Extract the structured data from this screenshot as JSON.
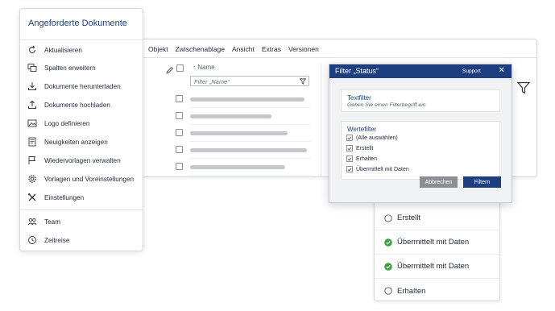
{
  "menubar": [
    "Objekt",
    "Zwischenablage",
    "Ansicht",
    "Extras",
    "Versionen"
  ],
  "grid": {
    "name_header": "↑ Name",
    "filter_placeholder": "Filter „Name“",
    "row_bar_fractions": [
      0.96,
      0.68,
      0.82,
      0.98,
      0.8
    ]
  },
  "sidebar": {
    "title": "Angeforderte Dokumente",
    "items": [
      {
        "label": "Aktualisieren",
        "icon": "refresh-icon"
      },
      {
        "label": "Spalten erweitern",
        "icon": "columns-icon"
      },
      {
        "label": "Dokumente herunterladen",
        "icon": "download-icon"
      },
      {
        "label": "Dokumente hochladen",
        "icon": "upload-icon"
      },
      {
        "label": "Logo definieren",
        "icon": "image-icon"
      },
      {
        "label": "Neuigkeiten anzeigen",
        "icon": "news-icon"
      },
      {
        "label": "Wiedervorlagen verwalten",
        "icon": "flag-icon"
      },
      {
        "label": "Vorlagen und Voreinstellungen",
        "icon": "gear-icon"
      },
      {
        "label": "Einstellungen",
        "icon": "tools-icon"
      }
    ],
    "footer_items": [
      {
        "label": "Team",
        "icon": "team-icon"
      },
      {
        "label": "Zeitreise",
        "icon": "time-travel-icon"
      }
    ]
  },
  "popup": {
    "title": "Filter „Status“",
    "support": "Support",
    "close": "✕",
    "text_filter": {
      "title": "Textfilter",
      "placeholder": "Geben Sie einen Filterbegriff ein"
    },
    "value_filter": {
      "title": "Wertefilter",
      "items": [
        {
          "label": "(Alle auswählen)",
          "checked": true
        },
        {
          "label": "Erstellt",
          "checked": true
        },
        {
          "label": "Erhalten",
          "checked": true
        },
        {
          "label": "Übermittelt mit Daten",
          "checked": true
        }
      ]
    },
    "cancel_label": "Abbrechen",
    "filter_label": "Filtern"
  },
  "status_list": [
    {
      "label": "Erstellt",
      "state": "open"
    },
    {
      "label": "Übermittelt mit Daten",
      "state": "done"
    },
    {
      "label": "Übermittelt mit Daten",
      "state": "done"
    },
    {
      "label": "Erhalten",
      "state": "open"
    }
  ],
  "colors": {
    "brand_blue": "#1d3f7f",
    "success_green": "#3aa143",
    "cancel_gray": "#8b8e92"
  }
}
